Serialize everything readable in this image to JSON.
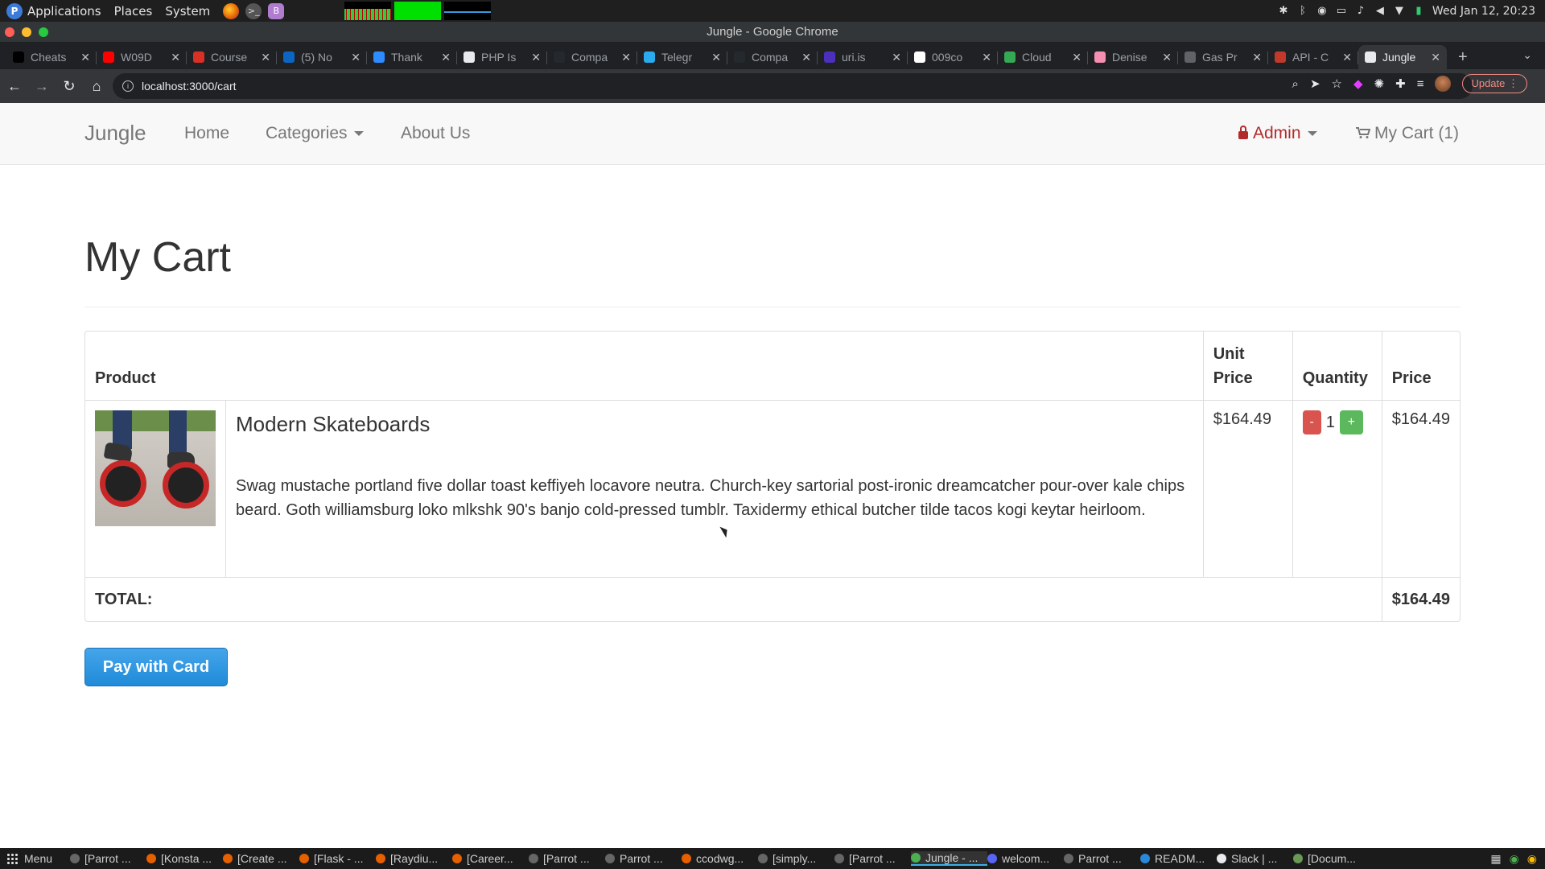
{
  "os": {
    "menus": [
      "Applications",
      "Places",
      "System"
    ],
    "clock": "Wed Jan 12, 20:23"
  },
  "window": {
    "title": "Jungle - Google Chrome"
  },
  "tabs": [
    {
      "label": "Cheats",
      "color": "#000000"
    },
    {
      "label": "W09D",
      "color": "#ff0000"
    },
    {
      "label": "Course",
      "color": "#d93025"
    },
    {
      "label": "(5) No",
      "color": "#0a66c2"
    },
    {
      "label": "Thank",
      "color": "#2d8cff"
    },
    {
      "label": "PHP Is",
      "color": "#e8eaed"
    },
    {
      "label": "Compa",
      "color": "#24292e"
    },
    {
      "label": "Telegr",
      "color": "#2aabee"
    },
    {
      "label": "Compa",
      "color": "#24292e"
    },
    {
      "label": "uri.is",
      "color": "#4b2fbd"
    },
    {
      "label": "009co",
      "color": "#ffffff"
    },
    {
      "label": "Cloud",
      "color": "#34a853"
    },
    {
      "label": "Denise",
      "color": "#f48fb1"
    },
    {
      "label": "Gas Pr",
      "color": "#5f6368"
    },
    {
      "label": "API - C",
      "color": "#c0392b"
    },
    {
      "label": "Jungle",
      "color": "#e8eaed",
      "active": true
    }
  ],
  "browser": {
    "url": "localhost:3000/cart",
    "update_label": "Update"
  },
  "navbar": {
    "brand": "Jungle",
    "home": "Home",
    "categories": "Categories",
    "about": "About Us",
    "admin": "Admin",
    "cart": "My Cart (1)"
  },
  "cart": {
    "title": "My Cart",
    "headers": {
      "product": "Product",
      "unit_price_1": "Unit",
      "unit_price_2": "Price",
      "quantity": "Quantity",
      "price": "Price"
    },
    "items": [
      {
        "name": "Modern Skateboards",
        "description": "Swag mustache portland five dollar toast keffiyeh locavore neutra. Church-key sartorial post-ironic dreamcatcher pour-over kale chips beard. Goth williamsburg loko mlkshk 90's banjo cold-pressed tumblr. Taxidermy ethical butcher tilde tacos kogi keytar heirloom.",
        "unit_price": "$164.49",
        "quantity": "1",
        "price": "$164.49",
        "minus_label": "-",
        "plus_label": "+"
      }
    ],
    "total_label": "TOTAL:",
    "total": "$164.49",
    "pay_label": "Pay with Card"
  },
  "taskbar": {
    "menu_label": "Menu",
    "items": [
      "[Parrot ...",
      "[Konsta ...",
      "[Create ...",
      "[Flask - ...",
      "[Raydiu...",
      "[Career...",
      "[Parrot ...",
      "Parrot ...",
      "ccodwg...",
      "[simply...",
      "[Parrot ...",
      "Jungle - ...",
      "welcom...",
      "Parrot ...",
      "READM...",
      "Slack | ...",
      "[Docum..."
    ]
  }
}
